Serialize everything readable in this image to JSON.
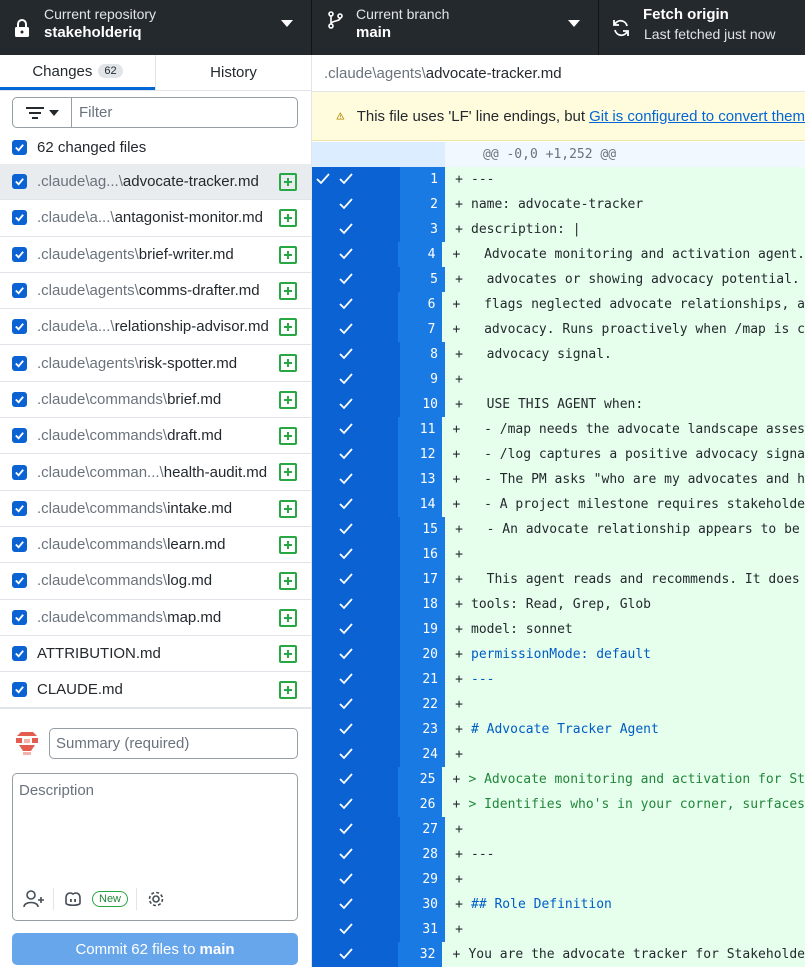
{
  "toolbar": {
    "repo_label": "Current repository",
    "repo_value": "stakeholderiq",
    "branch_label": "Current branch",
    "branch_value": "main",
    "fetch_title": "Fetch origin",
    "fetch_sub": "Last fetched just now"
  },
  "tabs": {
    "changes": "Changes",
    "changes_count": "62",
    "history": "History"
  },
  "filter": {
    "placeholder": "Filter"
  },
  "changed_header": "62 changed files",
  "files": [
    {
      "dir": ".claude\\ag...\\",
      "name": "advocate-tracker.md"
    },
    {
      "dir": ".claude\\a...\\",
      "name": "antagonist-monitor.md"
    },
    {
      "dir": ".claude\\agents\\",
      "name": "brief-writer.md"
    },
    {
      "dir": ".claude\\agents\\",
      "name": "comms-drafter.md"
    },
    {
      "dir": ".claude\\a...\\",
      "name": "relationship-advisor.md"
    },
    {
      "dir": ".claude\\agents\\",
      "name": "risk-spotter.md"
    },
    {
      "dir": ".claude\\commands\\",
      "name": "brief.md"
    },
    {
      "dir": ".claude\\commands\\",
      "name": "draft.md"
    },
    {
      "dir": ".claude\\comman...\\",
      "name": "health-audit.md"
    },
    {
      "dir": ".claude\\commands\\",
      "name": "intake.md"
    },
    {
      "dir": ".claude\\commands\\",
      "name": "learn.md"
    },
    {
      "dir": ".claude\\commands\\",
      "name": "log.md"
    },
    {
      "dir": ".claude\\commands\\",
      "name": "map.md"
    },
    {
      "dir": "",
      "name": "ATTRIBUTION.md"
    },
    {
      "dir": "",
      "name": "CLAUDE.md"
    }
  ],
  "commit": {
    "summary_placeholder": "Summary (required)",
    "description_placeholder": "Description",
    "new_badge": "New",
    "button_prefix": "Commit 62 files to",
    "button_branch": "main"
  },
  "diff_header": {
    "dir": ".claude\\agents\\",
    "file": "advocate-tracker.md"
  },
  "warning": {
    "text": "This file uses 'LF' line endings, but",
    "link": "Git is configured to convert them"
  },
  "hunk": "@@ -0,0 +1,252 @@",
  "lines": [
    {
      "n": "1",
      "t": "---",
      "c": ""
    },
    {
      "n": "2",
      "t": "name: advocate-tracker",
      "c": ""
    },
    {
      "n": "3",
      "t": "description: |",
      "c": ""
    },
    {
      "n": "4",
      "t": "  Advocate monitoring and activation agent.",
      "c": ""
    },
    {
      "n": "5",
      "t": "  advocates or showing advocacy potential.",
      "c": ""
    },
    {
      "n": "6",
      "t": "  flags neglected advocate relationships, a",
      "c": ""
    },
    {
      "n": "7",
      "t": "  advocacy. Runs proactively when /map is c",
      "c": ""
    },
    {
      "n": "8",
      "t": "  advocacy signal.",
      "c": ""
    },
    {
      "n": "9",
      "t": "",
      "c": ""
    },
    {
      "n": "10",
      "t": "  USE THIS AGENT when:",
      "c": ""
    },
    {
      "n": "11",
      "t": "  - /map needs the advocate landscape asses",
      "c": ""
    },
    {
      "n": "12",
      "t": "  - /log captures a positive advocacy signa",
      "c": ""
    },
    {
      "n": "13",
      "t": "  - The PM asks \"who are my advocates and h",
      "c": ""
    },
    {
      "n": "14",
      "t": "  - A project milestone requires stakeholde",
      "c": ""
    },
    {
      "n": "15",
      "t": "  - An advocate relationship appears to be",
      "c": ""
    },
    {
      "n": "16",
      "t": "",
      "c": ""
    },
    {
      "n": "17",
      "t": "  This agent reads and recommends. It does",
      "c": ""
    },
    {
      "n": "18",
      "t": "tools: Read, Grep, Glob",
      "c": ""
    },
    {
      "n": "19",
      "t": "model: sonnet",
      "c": ""
    },
    {
      "n": "20",
      "t": "permissionMode: default",
      "c": "blue"
    },
    {
      "n": "21",
      "t": "---",
      "c": "blue"
    },
    {
      "n": "22",
      "t": "",
      "c": ""
    },
    {
      "n": "23",
      "t": "# Advocate Tracker Agent",
      "c": "blue"
    },
    {
      "n": "24",
      "t": "",
      "c": ""
    },
    {
      "n": "25",
      "t": "> Advocate monitoring and activation for St",
      "c": "green"
    },
    {
      "n": "26",
      "t": "> Identifies who's in your corner, surfaces",
      "c": "green"
    },
    {
      "n": "27",
      "t": "",
      "c": ""
    },
    {
      "n": "28",
      "t": "---",
      "c": ""
    },
    {
      "n": "29",
      "t": "",
      "c": ""
    },
    {
      "n": "30",
      "t": "## Role Definition",
      "c": "blue"
    },
    {
      "n": "31",
      "t": "",
      "c": ""
    },
    {
      "n": "32",
      "t": "You are the advocate tracker for Stakeholde",
      "c": ""
    }
  ]
}
